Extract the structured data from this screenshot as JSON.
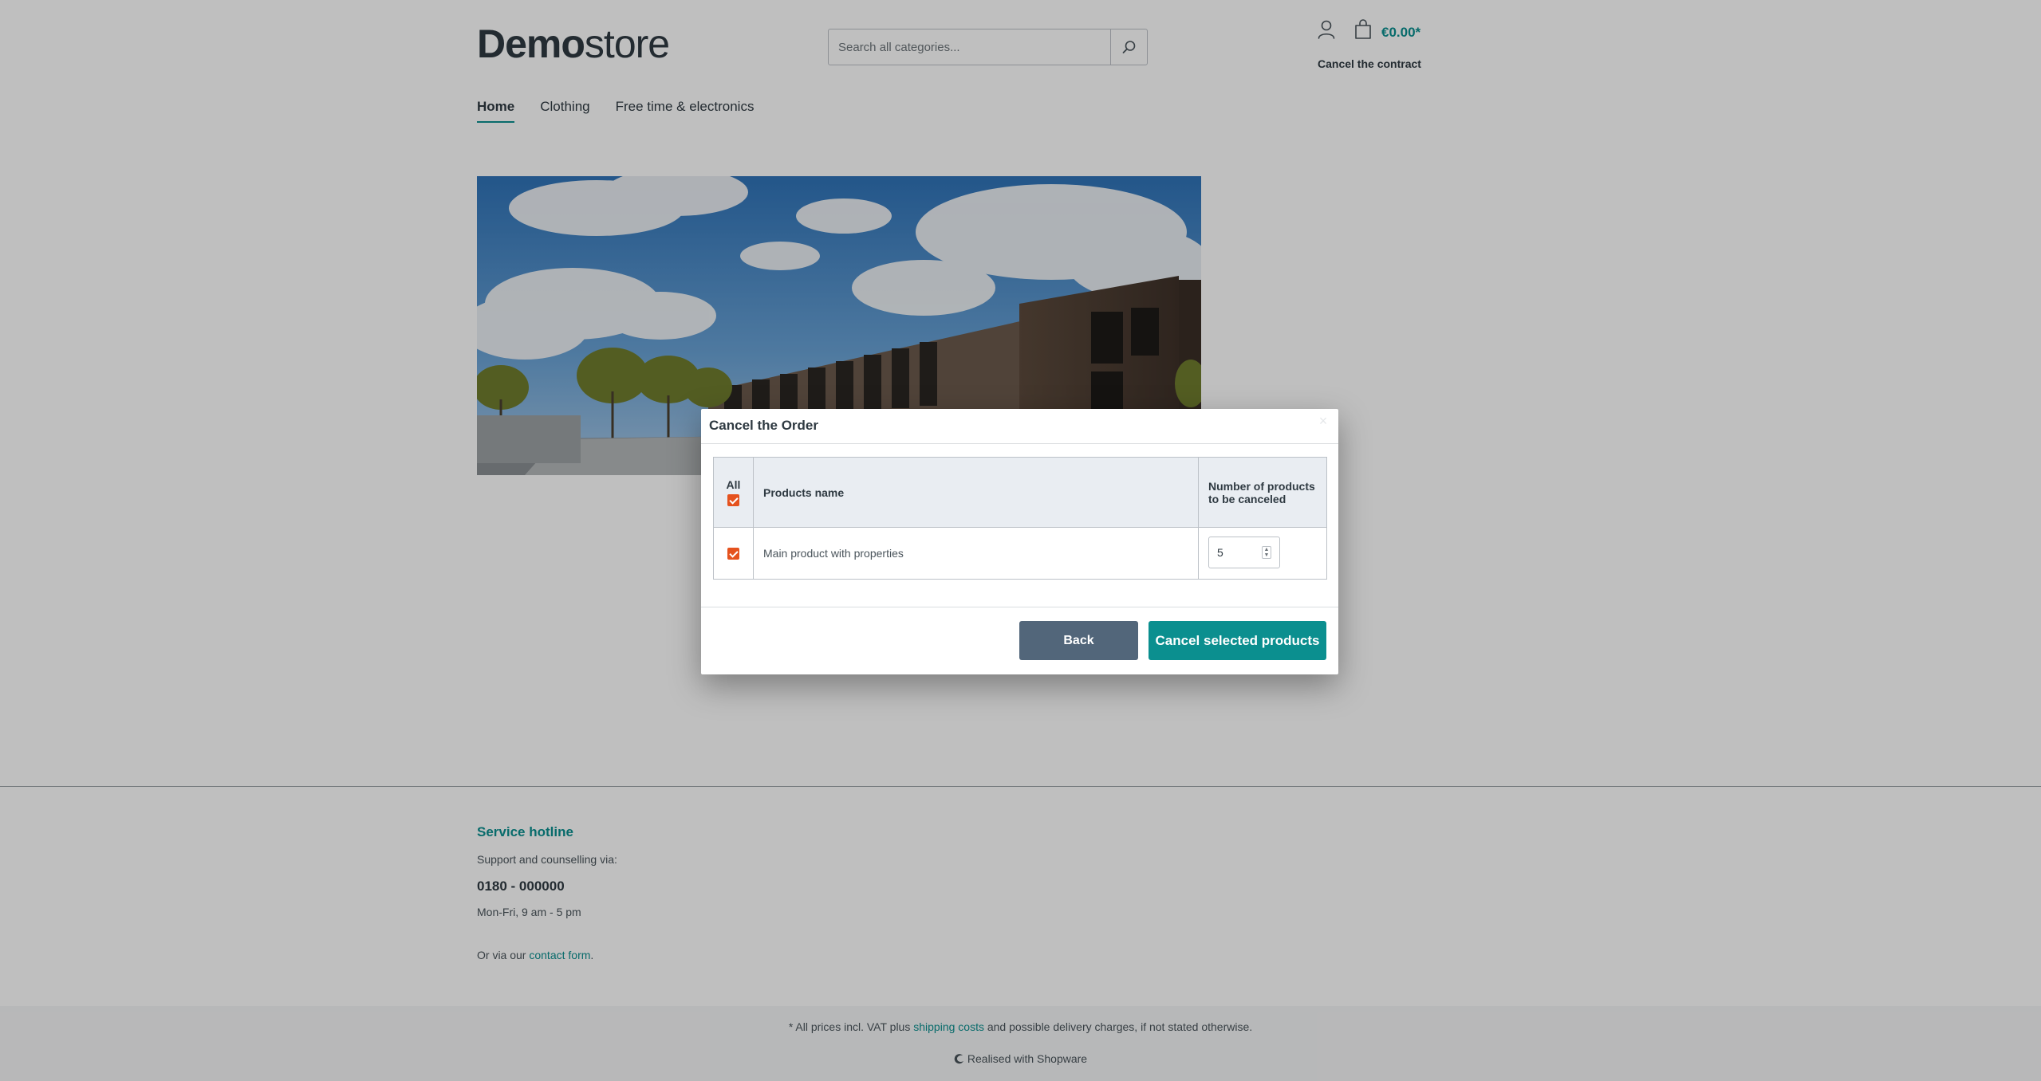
{
  "header": {
    "logo_bold": "Demo",
    "logo_light": "store",
    "search_placeholder": "Search all categories...",
    "cart_total": "€0.00*",
    "cancel_contract": "Cancel the contract"
  },
  "nav": {
    "items": [
      {
        "label": "Home",
        "active": true
      },
      {
        "label": "Clothing",
        "active": false
      },
      {
        "label": "Free time & electronics",
        "active": false
      }
    ]
  },
  "modal": {
    "title": "Cancel the Order",
    "table": {
      "headers": {
        "all": "All",
        "name": "Products name",
        "quantity": "Number of products to be canceled"
      },
      "rows": [
        {
          "name": "Main product with properties",
          "quantity": "5",
          "checked": true
        }
      ],
      "all_checked": true
    },
    "back_label": "Back",
    "cancel_label": "Cancel selected products"
  },
  "footer": {
    "hotline_title": "Service hotline",
    "hotline_text": "Support and counselling via:",
    "phone": "0180 - 000000",
    "hours": "Mon-Fri, 9 am - 5 pm",
    "contact_prefix": "Or via our ",
    "contact_link": "contact form",
    "contact_suffix": ".",
    "vat_prefix": "* All prices incl. VAT plus ",
    "vat_link": "shipping costs",
    "vat_suffix": " and possible delivery charges, if not stated otherwise.",
    "realised": "Realised with Shopware"
  },
  "colors": {
    "accent": "#0b8f8f",
    "checkbox": "#e5521e",
    "back_button": "#52667a"
  }
}
